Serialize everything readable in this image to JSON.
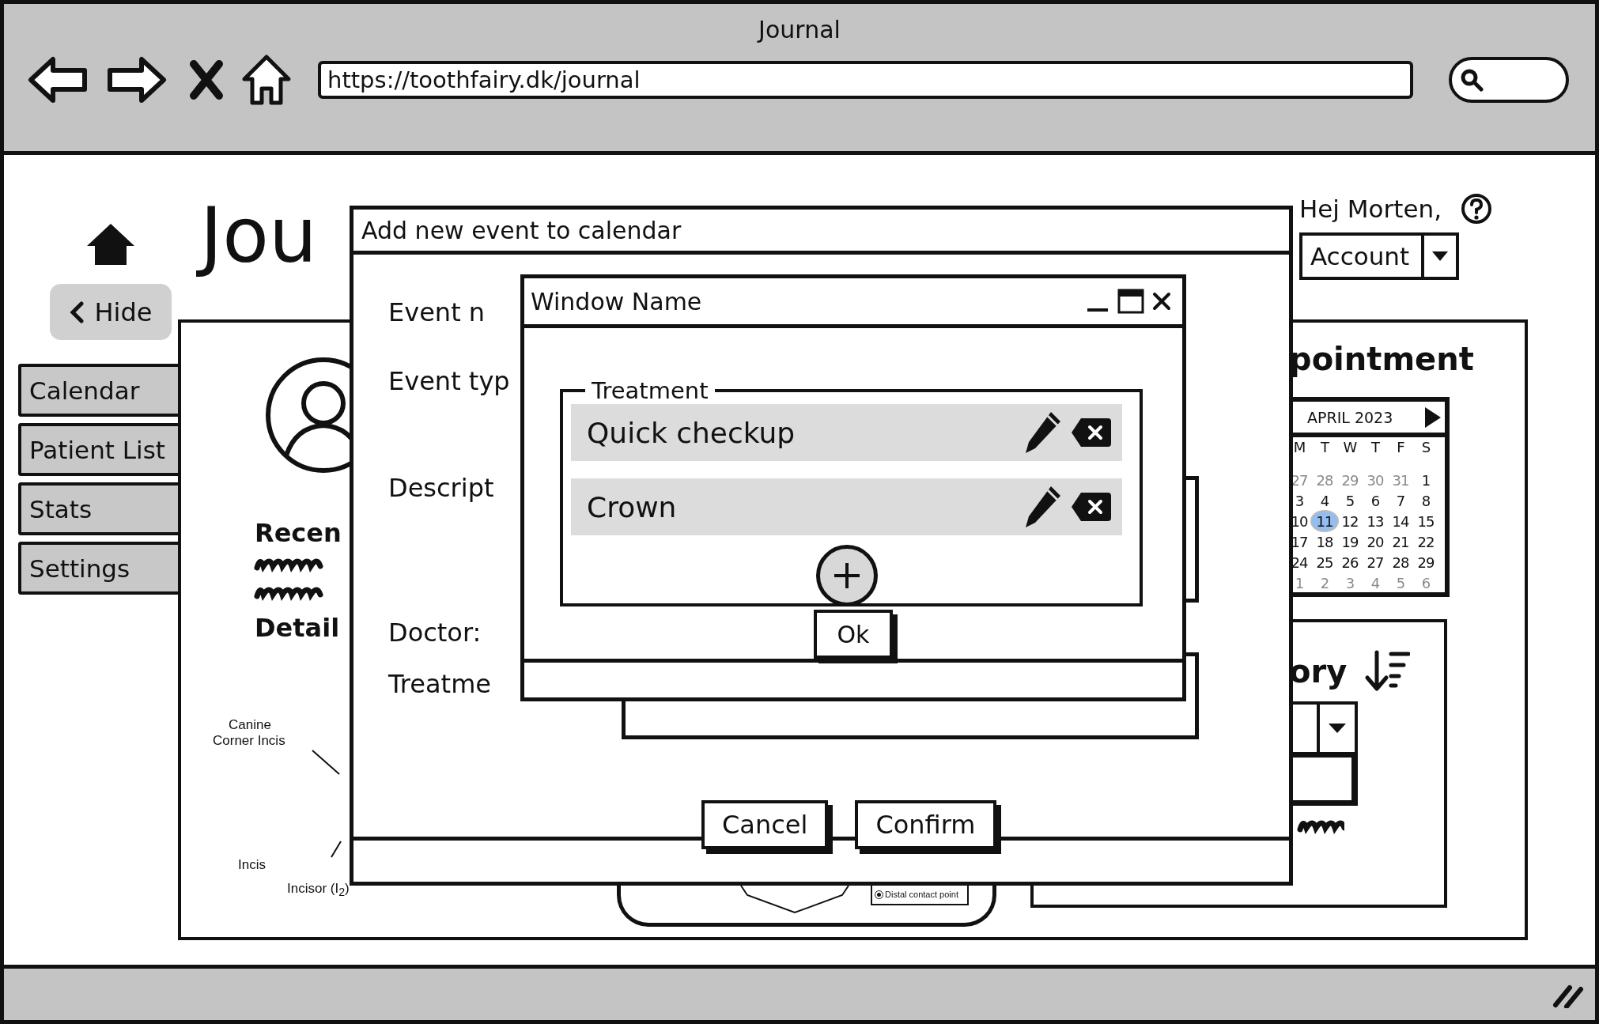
{
  "browser": {
    "title": "Journal",
    "url": "https://toothfairy.dk/journal"
  },
  "page": {
    "title": "Jou",
    "hide_button": "Hide",
    "greeting": "Hej Morten,",
    "account": "Account"
  },
  "sidebar": {
    "items": [
      {
        "label": "Calendar"
      },
      {
        "label": "Patient List"
      },
      {
        "label": "Stats"
      },
      {
        "label": "Settings"
      }
    ]
  },
  "patient": {
    "heading": "Recen",
    "details_heading": "Detail",
    "chart_labels": [
      "Canine",
      "Corner Incis",
      "Incis",
      "Incisor (I$_{2}$)"
    ],
    "chart_option": {
      "label": "Distal contact point",
      "selected": true
    }
  },
  "appointment": {
    "heading": "pointment",
    "calendar": {
      "month": "APRIL 2023",
      "weekdays": [
        "M",
        "T",
        "W",
        "T",
        "F",
        "S"
      ],
      "weeks": [
        [
          {
            "day": "27",
            "muted": true,
            "selected": false
          },
          {
            "day": "28",
            "muted": true,
            "selected": false
          },
          {
            "day": "29",
            "muted": true,
            "selected": false
          },
          {
            "day": "30",
            "muted": true,
            "selected": false
          },
          {
            "day": "31",
            "muted": true,
            "selected": false
          },
          {
            "day": "1",
            "muted": false,
            "selected": false
          }
        ],
        [
          {
            "day": "3",
            "muted": false,
            "selected": false
          },
          {
            "day": "4",
            "muted": false,
            "selected": false
          },
          {
            "day": "5",
            "muted": false,
            "selected": false
          },
          {
            "day": "6",
            "muted": false,
            "selected": false
          },
          {
            "day": "7",
            "muted": false,
            "selected": false
          },
          {
            "day": "8",
            "muted": false,
            "selected": false
          }
        ],
        [
          {
            "day": "10",
            "muted": false,
            "selected": false
          },
          {
            "day": "11",
            "muted": false,
            "selected": true
          },
          {
            "day": "12",
            "muted": false,
            "selected": false
          },
          {
            "day": "13",
            "muted": false,
            "selected": false
          },
          {
            "day": "14",
            "muted": false,
            "selected": false
          },
          {
            "day": "15",
            "muted": false,
            "selected": false
          }
        ],
        [
          {
            "day": "17",
            "muted": false,
            "selected": false
          },
          {
            "day": "18",
            "muted": false,
            "selected": false
          },
          {
            "day": "19",
            "muted": false,
            "selected": false
          },
          {
            "day": "20",
            "muted": false,
            "selected": false
          },
          {
            "day": "21",
            "muted": false,
            "selected": false
          },
          {
            "day": "22",
            "muted": false,
            "selected": false
          }
        ],
        [
          {
            "day": "24",
            "muted": false,
            "selected": false
          },
          {
            "day": "25",
            "muted": false,
            "selected": false
          },
          {
            "day": "26",
            "muted": false,
            "selected": false
          },
          {
            "day": "27",
            "muted": false,
            "selected": false
          },
          {
            "day": "28",
            "muted": false,
            "selected": false
          },
          {
            "day": "29",
            "muted": false,
            "selected": false
          }
        ],
        [
          {
            "day": "1",
            "muted": true,
            "selected": false
          },
          {
            "day": "2",
            "muted": true,
            "selected": false
          },
          {
            "day": "3",
            "muted": true,
            "selected": false
          },
          {
            "day": "4",
            "muted": true,
            "selected": false
          },
          {
            "day": "5",
            "muted": true,
            "selected": false
          },
          {
            "day": "6",
            "muted": true,
            "selected": false
          }
        ]
      ]
    }
  },
  "history": {
    "heading": "ory"
  },
  "event_dialog": {
    "title": "Add new event to calendar",
    "labels": [
      "Event n",
      "Event typ",
      "Descript",
      "Doctor:",
      "Treatme"
    ],
    "buttons": [
      "Cancel",
      "Confirm"
    ]
  },
  "treatment_window": {
    "title": "Window Name",
    "group_label": "Treatment",
    "items": [
      {
        "name": "Quick checkup"
      },
      {
        "name": "Crown"
      }
    ],
    "ok_button": "Ok"
  }
}
